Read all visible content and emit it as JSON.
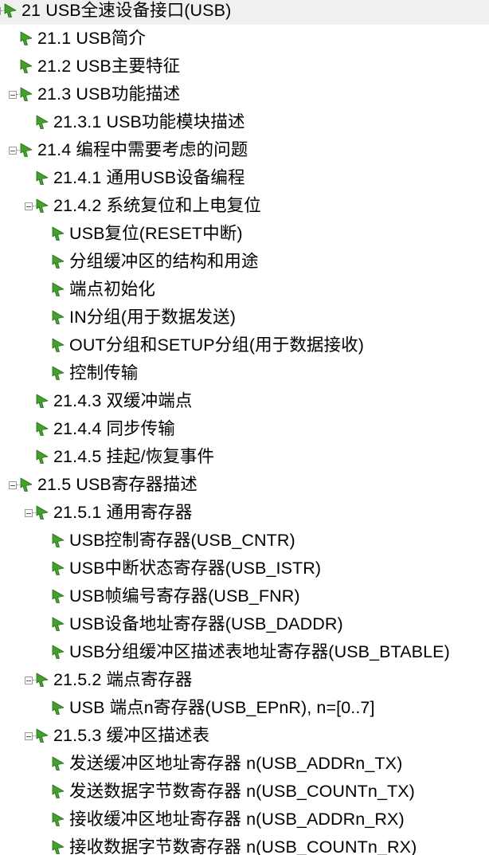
{
  "colors": {
    "icon_fill": "#43a02c",
    "icon_stroke": "#2a6b1a",
    "text": "#000000",
    "selected_bg": "#f0f0f0"
  },
  "outline": {
    "items": [
      {
        "level": 0,
        "label": "21 USB全速设备接口(USB)",
        "expander": true,
        "selected": true
      },
      {
        "level": 1,
        "label": "21.1 USB简介",
        "expander": false
      },
      {
        "level": 1,
        "label": "21.2 USB主要特征",
        "expander": false
      },
      {
        "level": 1,
        "label": "21.3 USB功能描述",
        "expander": true
      },
      {
        "level": 2,
        "label": "21.3.1 USB功能模块描述",
        "expander": false
      },
      {
        "level": 1,
        "label": "21.4 编程中需要考虑的问题",
        "expander": true
      },
      {
        "level": 2,
        "label": "21.4.1 通用USB设备编程",
        "expander": false
      },
      {
        "level": 2,
        "label": "21.4.2 系统复位和上电复位",
        "expander": true
      },
      {
        "level": 3,
        "label": "USB复位(RESET中断)",
        "expander": false
      },
      {
        "level": 3,
        "label": "分组缓冲区的结构和用途",
        "expander": false
      },
      {
        "level": 3,
        "label": "端点初始化",
        "expander": false
      },
      {
        "level": 3,
        "label": "IN分组(用于数据发送)",
        "expander": false
      },
      {
        "level": 3,
        "label": "OUT分组和SETUP分组(用于数据接收)",
        "expander": false
      },
      {
        "level": 3,
        "label": "控制传输",
        "expander": false
      },
      {
        "level": 2,
        "label": "21.4.3 双缓冲端点",
        "expander": false
      },
      {
        "level": 2,
        "label": "21.4.4 同步传输",
        "expander": false
      },
      {
        "level": 2,
        "label": "21.4.5 挂起/恢复事件",
        "expander": false
      },
      {
        "level": 1,
        "label": "21.5 USB寄存器描述",
        "expander": true
      },
      {
        "level": 2,
        "label": "21.5.1 通用寄存器",
        "expander": true
      },
      {
        "level": 3,
        "label": "USB控制寄存器(USB_CNTR)",
        "expander": false
      },
      {
        "level": 3,
        "label": "USB中断状态寄存器(USB_ISTR)",
        "expander": false
      },
      {
        "level": 3,
        "label": "USB帧编号寄存器(USB_FNR)",
        "expander": false
      },
      {
        "level": 3,
        "label": "USB设备地址寄存器(USB_DADDR)",
        "expander": false
      },
      {
        "level": 3,
        "label": "USB分组缓冲区描述表地址寄存器(USB_BTABLE)",
        "expander": false
      },
      {
        "level": 2,
        "label": "21.5.2 端点寄存器",
        "expander": true
      },
      {
        "level": 3,
        "label": "USB 端点n寄存器(USB_EPnR), n=[0..7]",
        "expander": false
      },
      {
        "level": 2,
        "label": "21.5.3 缓冲区描述表",
        "expander": true
      },
      {
        "level": 3,
        "label": "发送缓冲区地址寄存器 n(USB_ADDRn_TX)",
        "expander": false
      },
      {
        "level": 3,
        "label": "发送数据字节数寄存器 n(USB_COUNTn_TX)",
        "expander": false
      },
      {
        "level": 3,
        "label": "接收缓冲区地址寄存器 n(USB_ADDRn_RX)",
        "expander": false
      },
      {
        "level": 3,
        "label": "接收数据字节数寄存器 n(USB_COUNTn_RX)",
        "expander": false
      }
    ]
  }
}
